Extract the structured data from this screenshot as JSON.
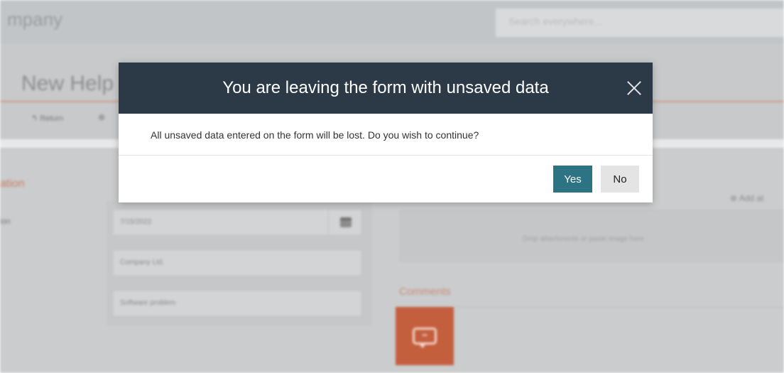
{
  "app": {
    "title": "mpany"
  },
  "search": {
    "placeholder": "Search everywhere..."
  },
  "page": {
    "title": "New Help"
  },
  "toolbar": {
    "return_label": "↰ Return",
    "new_label": "⊕"
  },
  "form": {
    "section_title": "ation",
    "row_label": "ion",
    "fields": [
      {
        "value": "7/15/2022"
      },
      {
        "value": "Company Ltd."
      },
      {
        "value": "Software problem"
      }
    ]
  },
  "attachments": {
    "add_label": "⊕ Add at",
    "drop_text": "Drop attachments or paste image here"
  },
  "comments": {
    "title": "Comments"
  },
  "modal": {
    "title": "You are leaving the form with unsaved data",
    "message": "All unsaved data entered on the form will be lost. Do you wish to continue?",
    "yes_label": "Yes",
    "no_label": "No"
  },
  "colors": {
    "modal_header": "#2c3a48",
    "primary_button": "#2c7484",
    "secondary_button": "#e4e4e4",
    "accent": "#c45f3e"
  },
  "icons": {
    "close": "close-icon",
    "calendar": "calendar-icon",
    "comment": "comment-bubble-icon",
    "plus": "plus-circle-icon"
  }
}
